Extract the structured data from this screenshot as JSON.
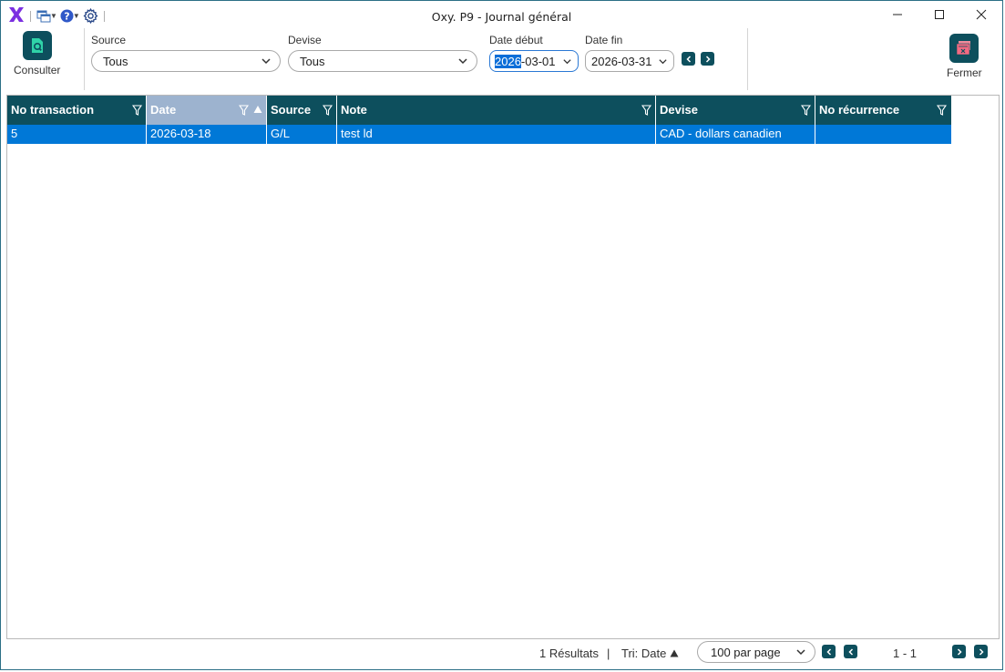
{
  "window": {
    "title": "Oxy. P9 - Journal général"
  },
  "ribbon": {
    "consult_label": "Consulter",
    "close_label": "Fermer",
    "filters": {
      "source_label": "Source",
      "source_value": "Tous",
      "currency_label": "Devise",
      "currency_value": "Tous",
      "start_label": "Date début",
      "start_value_selected": "2026",
      "start_value_rest": "-03-01",
      "end_label": "Date fin",
      "end_value": "2026-03-31"
    }
  },
  "grid": {
    "columns": [
      {
        "label": "No transaction",
        "filterable": true
      },
      {
        "label": "Date",
        "filterable": true,
        "sorted": "asc"
      },
      {
        "label": "Source",
        "filterable": true
      },
      {
        "label": "Note",
        "filterable": true
      },
      {
        "label": "Devise",
        "filterable": true
      },
      {
        "label": "No récurrence",
        "filterable": true
      }
    ],
    "rows": [
      {
        "no_transaction": "5",
        "date": "2026-03-18",
        "source": "G/L",
        "note": "test ld",
        "devise": "CAD - dollars canadien",
        "no_recurrence": ""
      }
    ]
  },
  "footer": {
    "results": "1 Résultats",
    "separator": "|",
    "sort": "Tri: Date",
    "page_size": "100 par page",
    "range": "1 - 1"
  },
  "colors": {
    "accent": "#0d4f5d",
    "selected_row": "#0078d7",
    "sorted_header": "#9db3cf",
    "logo_purple": "#7b2fe0"
  }
}
